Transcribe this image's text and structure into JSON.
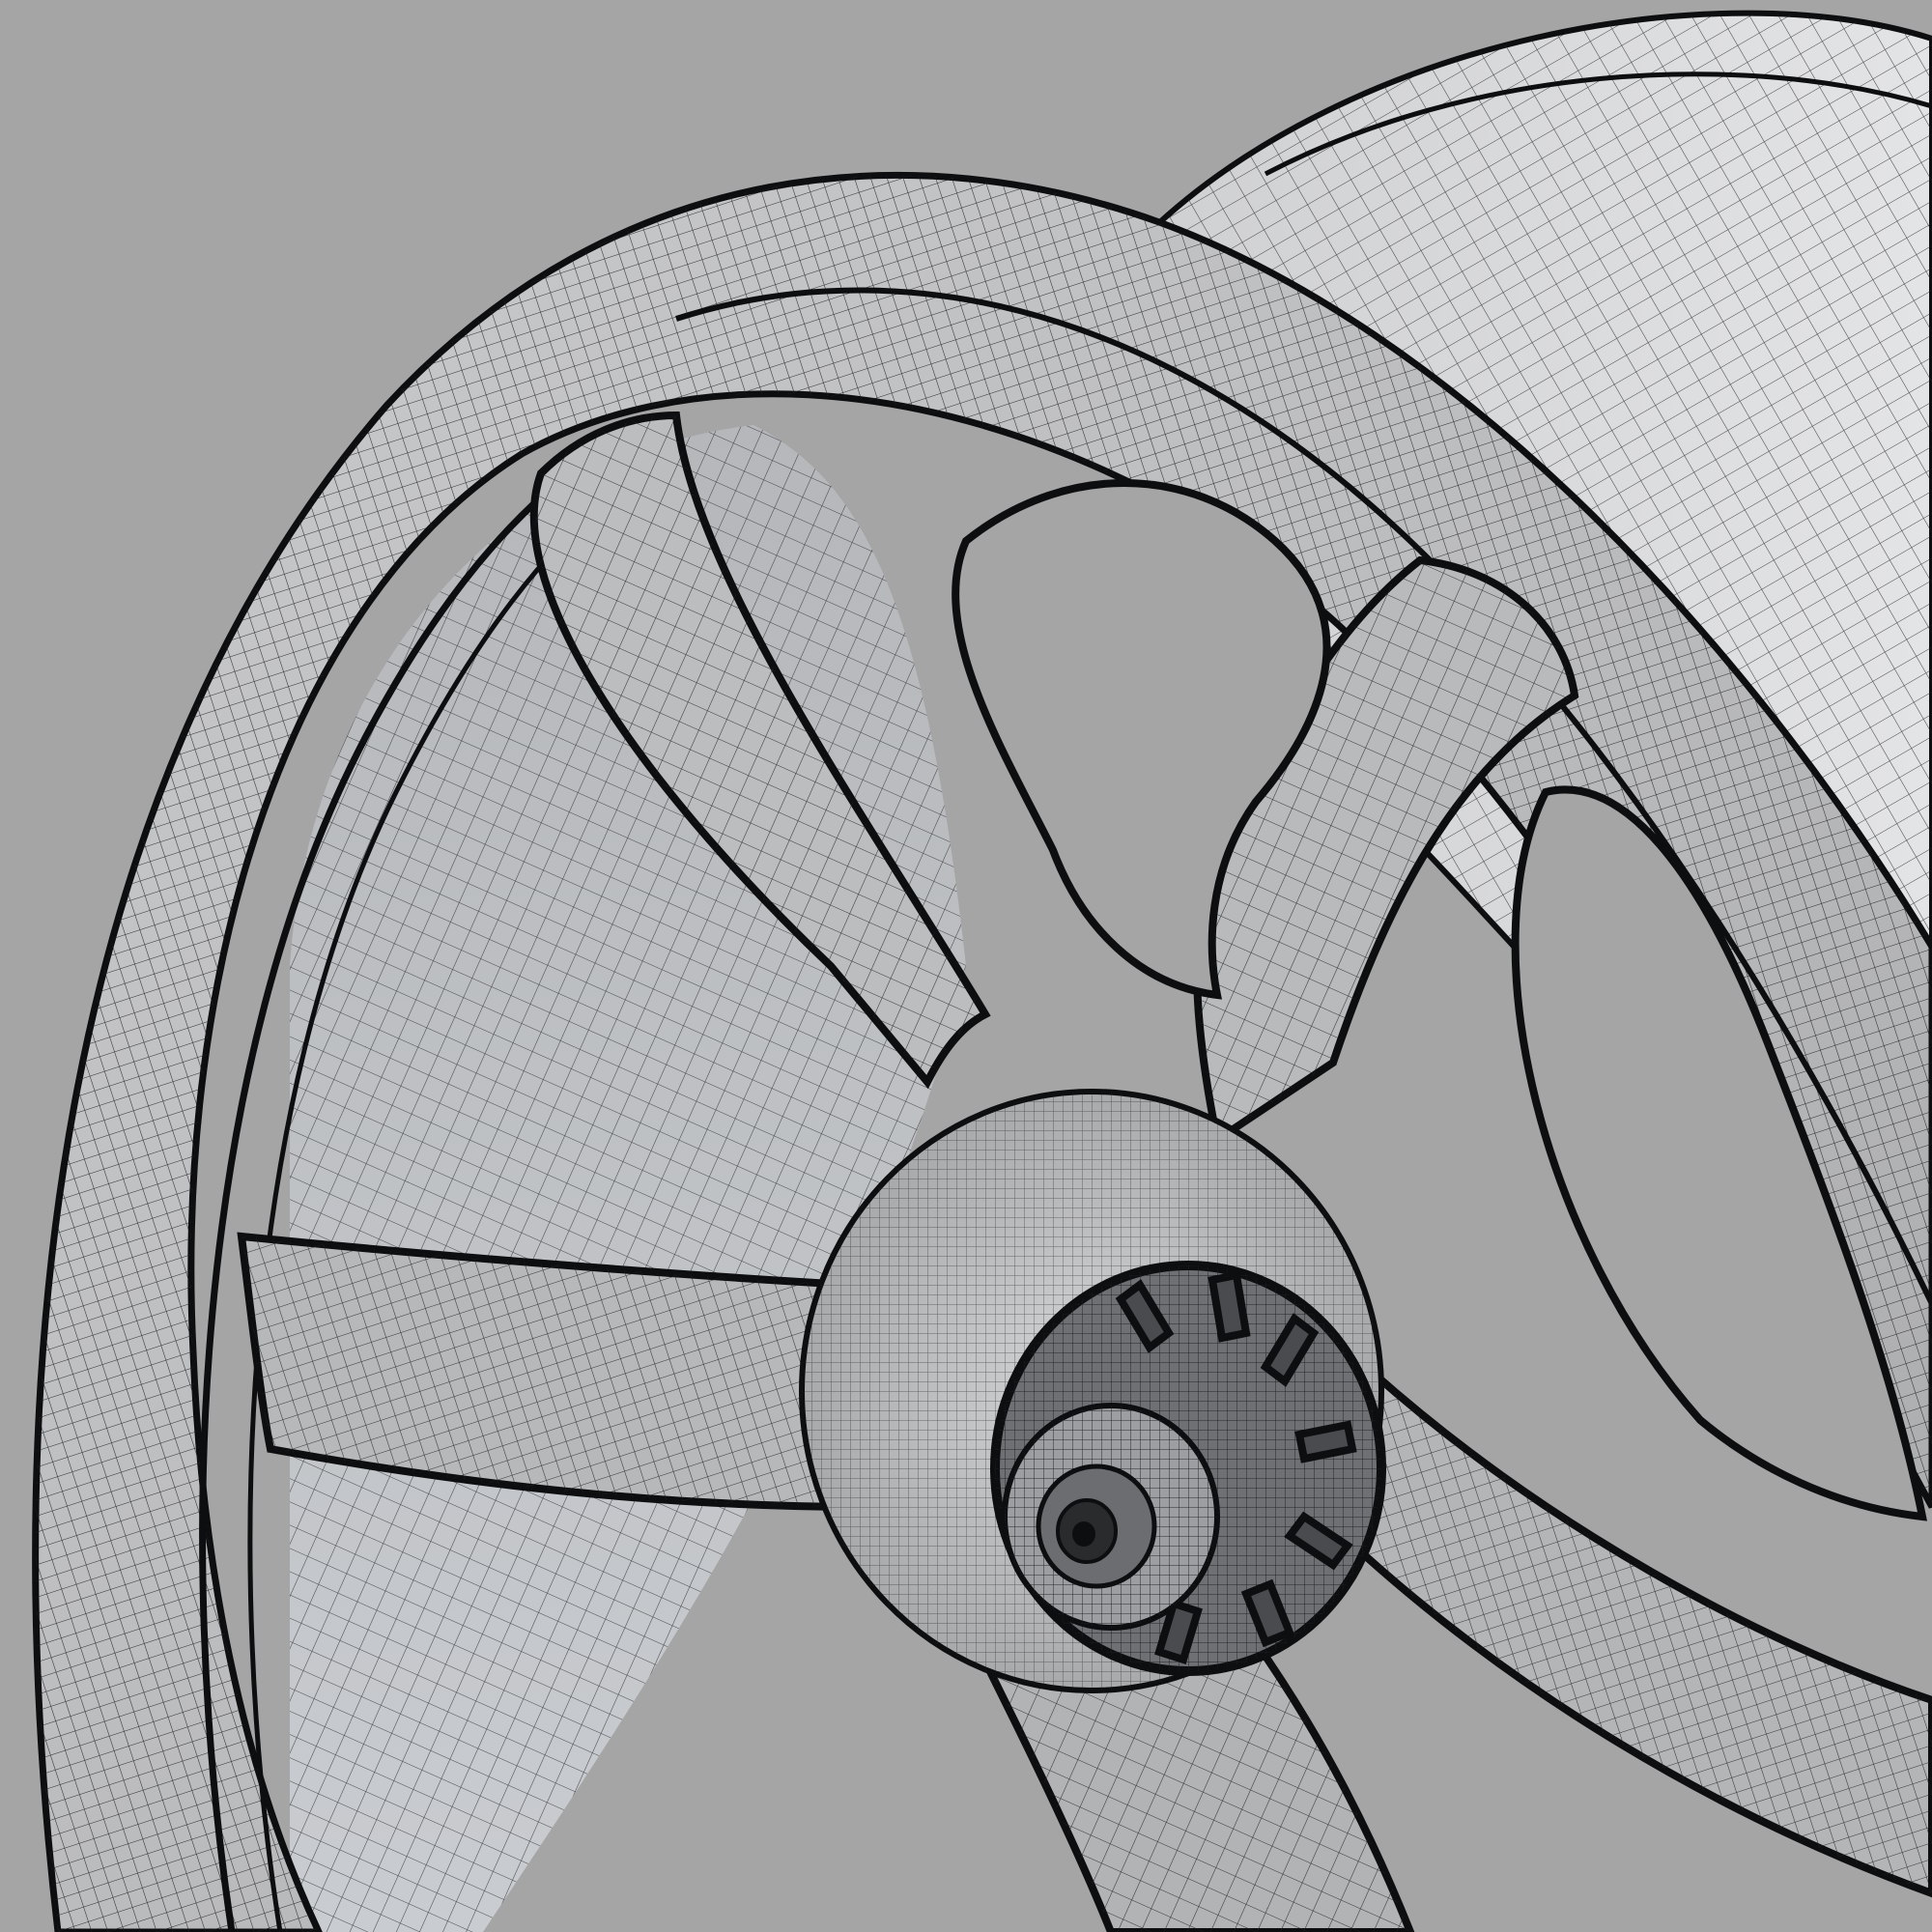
{
  "scene": {
    "subject": "wheel-rim-wireframe-render",
    "colors": {
      "background": "#a5a5a5",
      "surface_light": "#d9dadc",
      "surface_mid": "#b9babc",
      "surface_dark": "#8f9092",
      "wire": "#1c1e20",
      "edge": "#0d0e10"
    }
  }
}
